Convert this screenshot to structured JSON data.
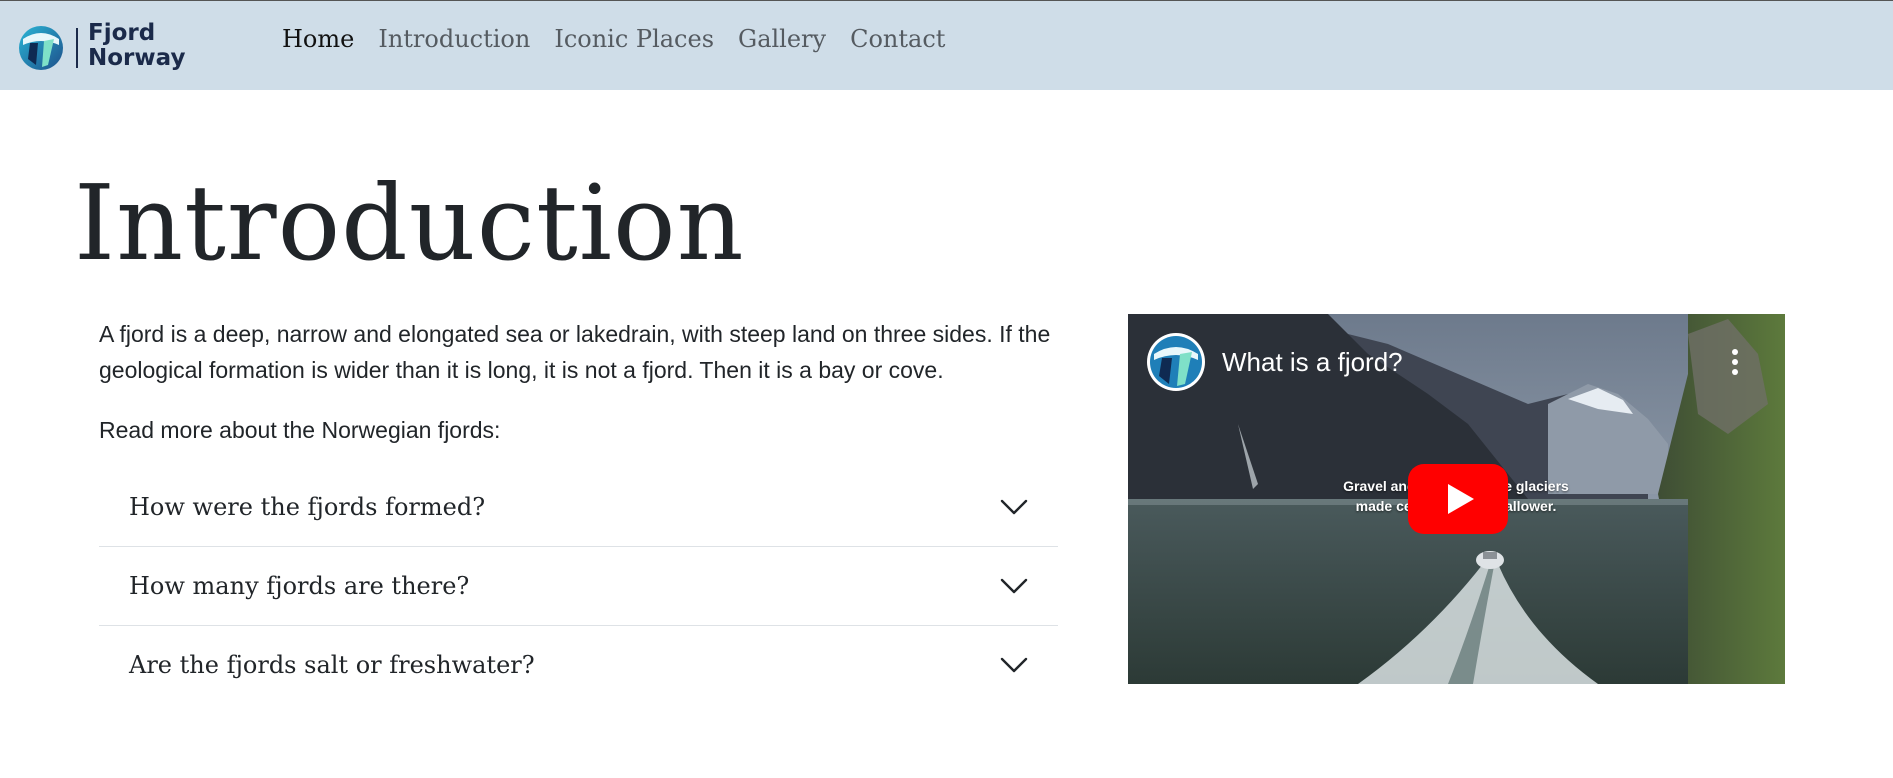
{
  "brand": {
    "line1": "Fjord",
    "line2": "Norway"
  },
  "nav": {
    "items": [
      {
        "label": "Home",
        "active": true
      },
      {
        "label": "Introduction",
        "active": false
      },
      {
        "label": "Iconic Places",
        "active": false
      },
      {
        "label": "Gallery",
        "active": false
      },
      {
        "label": "Contact",
        "active": false
      }
    ]
  },
  "main": {
    "title": "Introduction",
    "intro": "A fjord is a deep, narrow and elongated sea or lakedrain, with steep land on three sides. If the geological formation is wider than it is long, it is not a fjord. Then it is a bay or cove.",
    "read_more": "Read more about the Norwegian fjords:",
    "accordion": [
      {
        "label": "How were the fjords formed?"
      },
      {
        "label": "How many fjords are there?"
      },
      {
        "label": "Are the fjords salt or freshwater?"
      }
    ]
  },
  "video": {
    "title": "What is a fjord?",
    "caption_line1": "Gravel and sand from the glaciers",
    "caption_line2": "made certain fjords shallower.",
    "play_icon": "play-icon",
    "menu_icon": "more-vert-icon"
  },
  "colors": {
    "navbar_bg": "#cfdde8",
    "brand": "#1b2a4a",
    "play_red": "#ff0000"
  }
}
